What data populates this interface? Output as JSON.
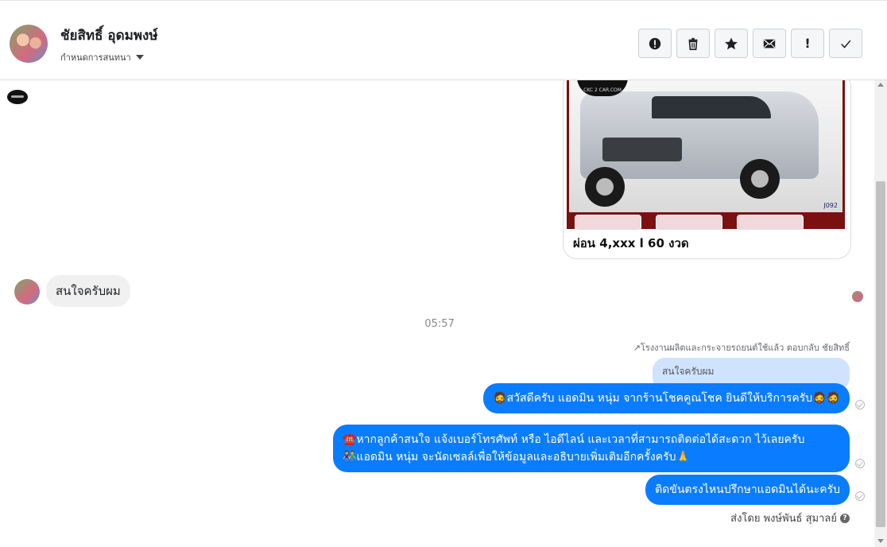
{
  "header": {
    "contact_name": "ชัยสิทธิ์ อุดมพงษ์",
    "conversation_settings": "กำหนดการสนทนา",
    "actions": [
      {
        "name": "mark-spam",
        "icon": "exclamation-circle-icon"
      },
      {
        "name": "delete",
        "icon": "trash-icon"
      },
      {
        "name": "star",
        "icon": "star-icon"
      },
      {
        "name": "mark-unread",
        "icon": "envelope-icon"
      },
      {
        "name": "follow-up",
        "label": "!"
      },
      {
        "name": "done",
        "icon": "check-icon"
      }
    ]
  },
  "card": {
    "logo_text": "CKC 2 CAR.COM",
    "image_code": "J092",
    "caption": "ผ่อน 4,xxx l 60 งวด"
  },
  "messages": {
    "incoming_text": "สนใจครับผม",
    "time": "05:57",
    "reply_note": "โรงงานผลิตและกระจายรถยนต์ใช้แล้ว ตอบกลับ ชัยสิทธิ์",
    "quoted_text": "สนใจครับผม",
    "out1": "🧔สวัสดีครับ แอดมิน หนุ่ม จากร้านโชคคูณโชค ยินดีให้บริการครับ🧔🧔",
    "out2_line1": "☎️หากลูกค้าสนใจ แจ้งเบอร์โทรศัพท์ หรือ ไอดีไลน์ และเวลาที่สามารถติดต่อได้สะดวก ไว้เลยครับ",
    "out2_line2": "👫แอดมิน หนุ่ม จะนัดเซลล์เพื่อให้ข้อมูลและอธิบายเพิ่มเติมอีกครั้งครับ🙏",
    "out3": "ติดขันตรงไหนปรึกษาแอดมินได้นะครับ",
    "sent_by": "ส่งโดย พงษ์พันธ์ สุมาลย์"
  },
  "colors": {
    "bubble_out": "#0a7cff",
    "bubble_in": "#f0f0f0",
    "quoted_bg": "#cfe3ff"
  }
}
